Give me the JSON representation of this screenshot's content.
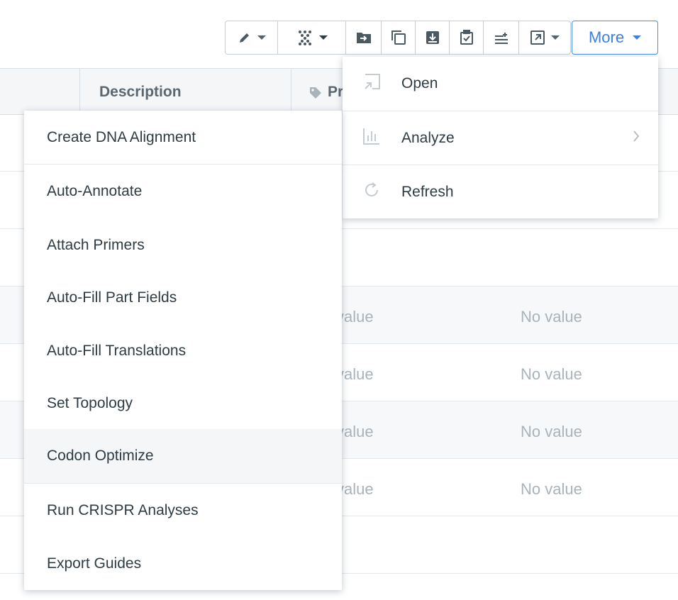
{
  "toolbar": {
    "items": [
      {
        "name": "edit",
        "icon": "pencil-icon",
        "dropdown": true
      },
      {
        "name": "sequence",
        "icon": "dna-icon",
        "dropdown": true
      },
      {
        "name": "move-to-folder",
        "icon": "folder-arrow-icon"
      },
      {
        "name": "copy",
        "icon": "copy-icon"
      },
      {
        "name": "archive",
        "icon": "archive-icon"
      },
      {
        "name": "register",
        "icon": "clipboard-check-icon"
      },
      {
        "name": "bulk-update",
        "icon": "list-plus-icon"
      },
      {
        "name": "export",
        "icon": "external-link-icon",
        "dropdown": true
      }
    ],
    "more_label": "More"
  },
  "table": {
    "columns": [
      {
        "label": "Description"
      },
      {
        "label": "Pr"
      }
    ],
    "rows": [
      {
        "col_a": "",
        "col_b": ""
      },
      {
        "col_a": "",
        "col_b": ""
      },
      {
        "col_a": "",
        "col_b": ""
      },
      {
        "col_a": "value",
        "col_b": "No value"
      },
      {
        "col_a": "value",
        "col_b": "No value"
      },
      {
        "col_a": "value",
        "col_b": "No value"
      },
      {
        "col_a": "value",
        "col_b": "No value"
      }
    ]
  },
  "more_menu": {
    "items": [
      {
        "label": "Open",
        "icon": "open-icon"
      },
      {
        "label": "Analyze",
        "icon": "bar-chart-icon",
        "submenu": true
      },
      {
        "label": "Refresh",
        "icon": "refresh-icon"
      }
    ]
  },
  "analyze_menu": {
    "items": [
      {
        "label": "Create DNA Alignment"
      },
      {
        "label": "Auto-Annotate"
      },
      {
        "label": "Attach Primers"
      },
      {
        "label": "Auto-Fill Part Fields"
      },
      {
        "label": "Auto-Fill Translations"
      },
      {
        "label": "Set Topology"
      },
      {
        "label": "Codon Optimize",
        "highlighted": true
      },
      {
        "label": "Run CRISPR Analyses"
      },
      {
        "label": "Export Guides"
      }
    ]
  },
  "colors": {
    "accent": "#3d80e0",
    "text": "#2e3b43",
    "muted": "#a8b3ba",
    "border": "#c4cfd6"
  }
}
